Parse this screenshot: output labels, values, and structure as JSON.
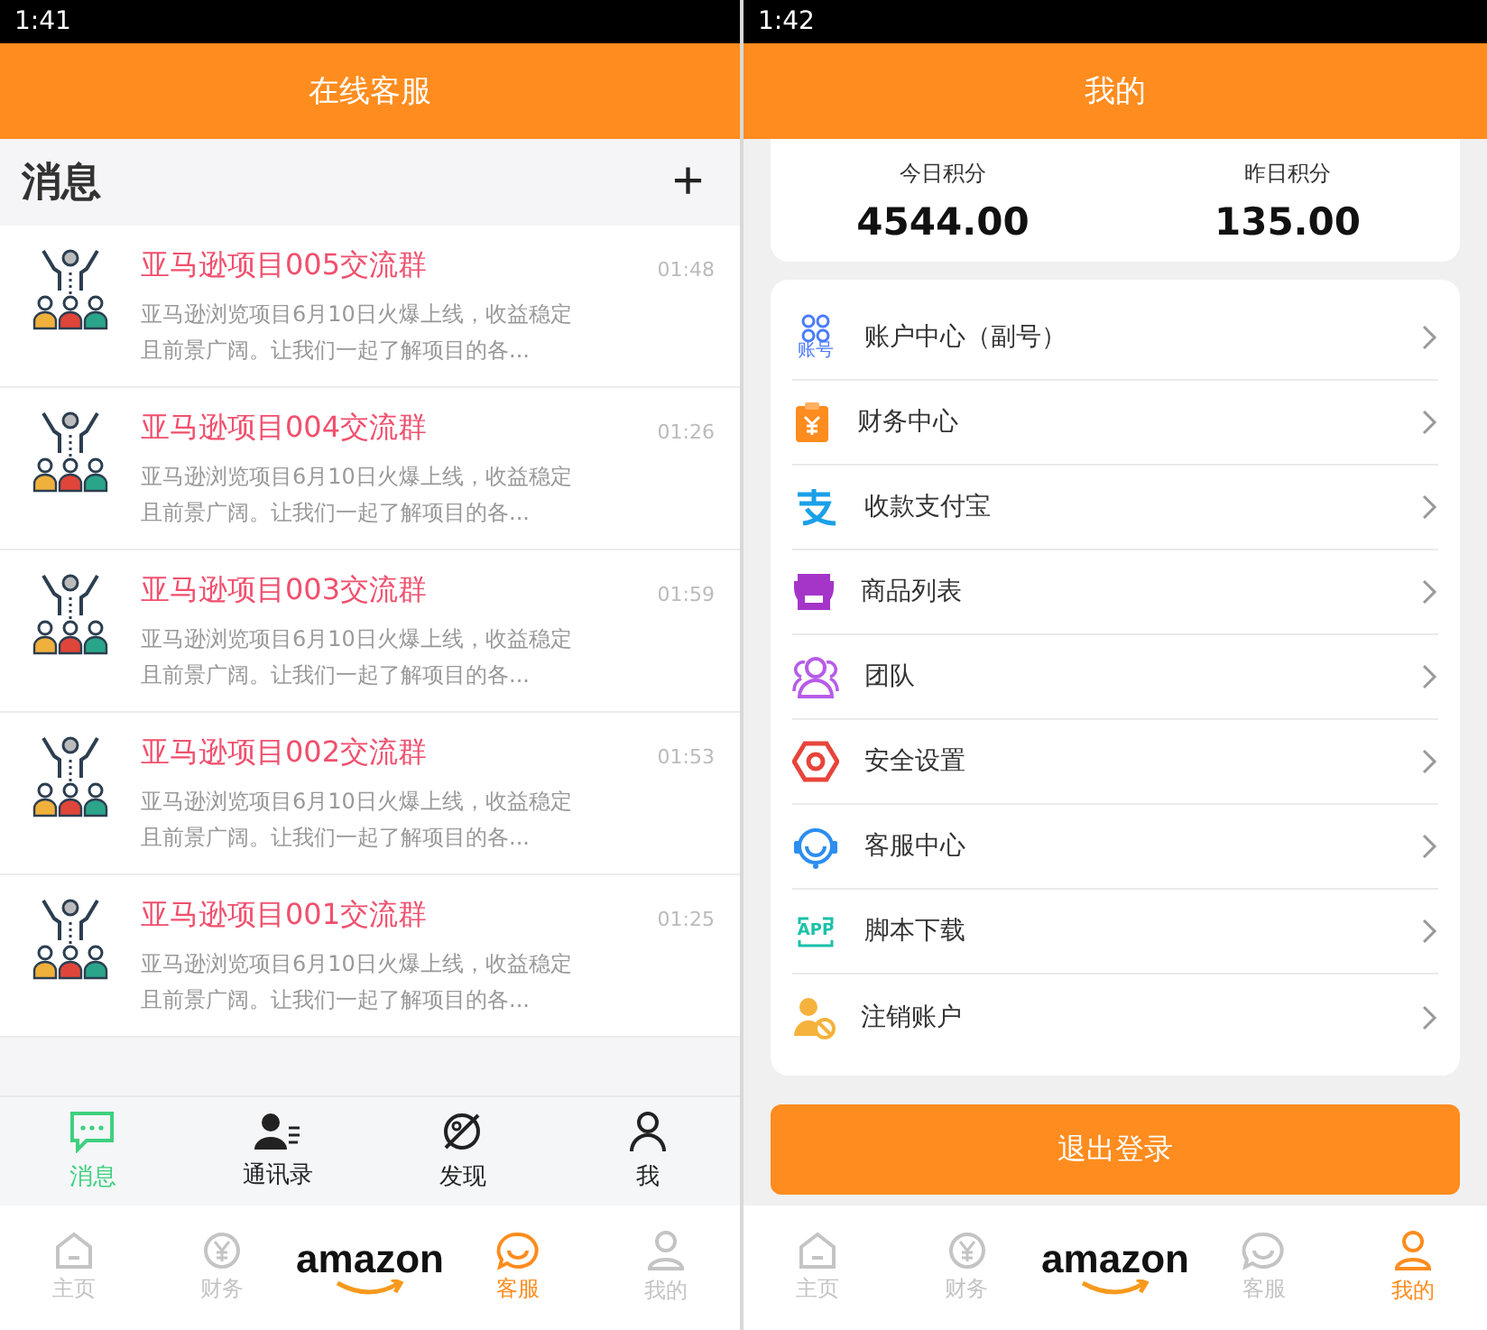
{
  "messages_screen": {
    "status_time": "1:41",
    "title": "在线客服",
    "section_title": "消息",
    "add_symbol": "+",
    "chats": [
      {
        "name": "亚马逊项目005交流群",
        "preview": "亚马逊浏览项目6月10日火爆上线，收益稳定且前景广阔。让我们一起了解项目的各...",
        "time": "01:48"
      },
      {
        "name": "亚马逊项目004交流群",
        "preview": "亚马逊浏览项目6月10日火爆上线，收益稳定且前景广阔。让我们一起了解项目的各...",
        "time": "01:26"
      },
      {
        "name": "亚马逊项目003交流群",
        "preview": "亚马逊浏览项目6月10日火爆上线，收益稳定且前景广阔。让我们一起了解项目的各...",
        "time": "01:59"
      },
      {
        "name": "亚马逊项目002交流群",
        "preview": "亚马逊浏览项目6月10日火爆上线，收益稳定且前景广阔。让我们一起了解项目的各...",
        "time": "01:53"
      },
      {
        "name": "亚马逊项目001交流群",
        "preview": "亚马逊浏览项目6月10日火爆上线，收益稳定且前景广阔。让我们一起了解项目的各...",
        "time": "01:25"
      }
    ],
    "chat_tabs": [
      {
        "label": "消息",
        "selected": true
      },
      {
        "label": "通讯录",
        "selected": false
      },
      {
        "label": "发现",
        "selected": false
      },
      {
        "label": "我",
        "selected": false
      }
    ],
    "bottom_nav": [
      {
        "kind": "tab",
        "label": "主页",
        "selected": false
      },
      {
        "kind": "tab",
        "label": "财务",
        "selected": false
      },
      {
        "kind": "logo",
        "label": "amazon"
      },
      {
        "kind": "tab",
        "label": "客服",
        "selected": true
      },
      {
        "kind": "tab",
        "label": "我的",
        "selected": false
      }
    ]
  },
  "profile_screen": {
    "status_time": "1:42",
    "title": "我的",
    "scores": [
      {
        "label": "今日积分",
        "value": "4544.00"
      },
      {
        "label": "昨日积分",
        "value": "135.00"
      }
    ],
    "menu": [
      {
        "label": "账户中心（副号）",
        "icon_text": "账号"
      },
      {
        "label": "财务中心"
      },
      {
        "label": "收款支付宝"
      },
      {
        "label": "商品列表"
      },
      {
        "label": "团队"
      },
      {
        "label": "安全设置"
      },
      {
        "label": "客服中心"
      },
      {
        "label": "脚本下载",
        "icon_text": "APP"
      },
      {
        "label": "注销账户"
      }
    ],
    "logout_button": "退出登录",
    "bottom_nav": [
      {
        "kind": "tab",
        "label": "主页",
        "selected": false
      },
      {
        "kind": "tab",
        "label": "财务",
        "selected": false
      },
      {
        "kind": "logo",
        "label": "amazon"
      },
      {
        "kind": "tab",
        "label": "客服",
        "selected": false
      },
      {
        "kind": "tab",
        "label": "我的",
        "selected": true
      }
    ]
  }
}
